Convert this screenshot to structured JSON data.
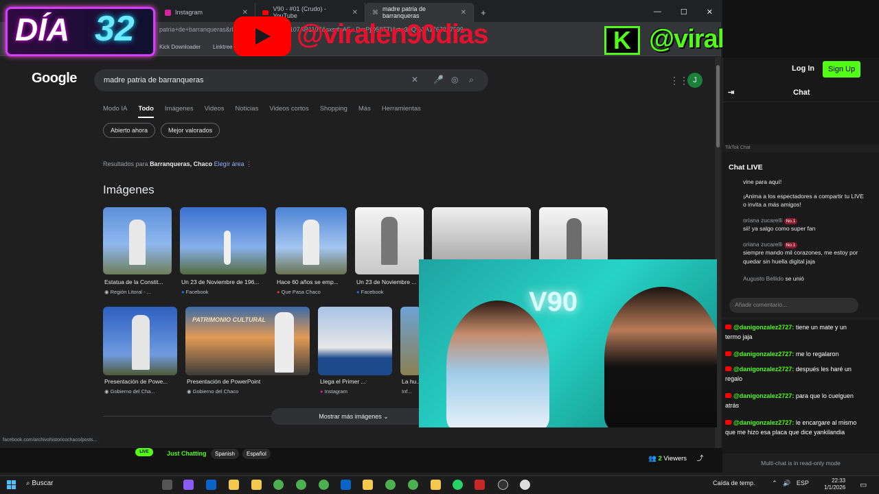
{
  "browser": {
    "tabs": [
      {
        "label": "Instagram",
        "icon": "instagram-icon"
      },
      {
        "label": "V90 - #01 (Crudo) - YouTube",
        "icon": "youtube-icon"
      },
      {
        "label": "madre patria de barranqueras",
        "icon": "google-icon"
      }
    ],
    "address": "patria+de+barranqueras&rlz=1C1CHBF_esAR1107AR1107&sxsrf=AE...DmPjQ58TTI&rtw39Q%3A1767317599",
    "bookmarks": [
      "Kick Downloader",
      "Linktree"
    ]
  },
  "google": {
    "logo": "Google",
    "query": "madre patria de barranqueras",
    "avatar_letter": "J",
    "tabs": [
      "Modo IA",
      "Todo",
      "Imágenes",
      "Videos",
      "Noticias",
      "Videos cortos",
      "Shopping",
      "Más",
      "Herramientas"
    ],
    "chips": [
      "Abierto ahora",
      "Mejor valorados"
    ],
    "location_prefix": "Resultados para",
    "location_place": "Barranqueras, Chaco",
    "location_link": "Elegír área",
    "images_title": "Imágenes",
    "row1": [
      {
        "caption": "Estatua de la Constit...",
        "source": "Región Litoral - ..."
      },
      {
        "caption": "Un 23 de Noviembre de 196...",
        "source": "Facebook"
      },
      {
        "caption": "Hace 60 años se emp...",
        "source": "Que Pasa Chaco"
      },
      {
        "caption": "Un 23 de Noviembre ...",
        "source": "Facebook"
      }
    ],
    "row2": [
      {
        "caption": "Presentación de Powe...",
        "source": "Gobierno del Cha..."
      },
      {
        "caption": "Presentación de PowerPoint",
        "source": "Gobierno del Chaco",
        "overlay": "PATRIMONIO CULTURAL"
      },
      {
        "caption": "Llega el Primer ...",
        "source": "Instagram"
      },
      {
        "caption": "La hu...",
        "source": "Inf..."
      }
    ],
    "more_images": "Mostrar más imágenes",
    "status_url": "facebook.com/archivohistoricochaco/posts..."
  },
  "overlay": {
    "day_word": "DÍA",
    "day_number": "32",
    "yt_handle": "@viralen90dias",
    "kick_letter": "K",
    "kick_handle": "@viralen90dias",
    "cam_sign": "V90"
  },
  "kick": {
    "login": "Log In",
    "signup": "Sign Up",
    "chat_title": "Chat",
    "live_badge": "LIVE",
    "category": "Just Chatting",
    "tags": [
      "Spanish",
      "Español"
    ],
    "viewers_count": "2",
    "viewers_label": "Viewers",
    "read_only": "Multi-chat is in read-only mode",
    "messages": [
      {
        "user": "@danigonzalez2727:",
        "text": "tiene un mate y un termo jaja"
      },
      {
        "user": "@danigonzalez2727:",
        "text": "me lo regalaron"
      },
      {
        "user": "@danigonzalez2727:",
        "text": "después les haré un regalo"
      },
      {
        "user": "@danigonzalez2727:",
        "text": "para que lo cuelguen atrás"
      },
      {
        "user": "@danigonzalez2727:",
        "text": "le encargare al mismo que me hizo esa placa que dice yankilandia"
      }
    ]
  },
  "tiktok": {
    "label": "TikTok Chat",
    "title": "Chat LIVE",
    "items": [
      {
        "name": "",
        "badge": "",
        "text": "vine para aquí!"
      },
      {
        "name": "",
        "badge": "",
        "text": "¡Anima a los espectadores a compartir tu LIVE o invita a más amigos!"
      },
      {
        "name": "oriana zucarelli",
        "badge": "No.1",
        "text": "sii! ya salgo como super fan"
      },
      {
        "name": "oriana zucarelli",
        "badge": "No.1",
        "text": "siempre mando mil corazones, me estoy por quedar sin huella digital jaja"
      },
      {
        "name": "Augusto Bellido",
        "badge": "",
        "text": "se unió"
      }
    ],
    "input_placeholder": "Añadir comentario..."
  },
  "taskbar": {
    "search": "Buscar",
    "weather": "Caída de temp.",
    "lang": "ESP",
    "time": "22:33",
    "date": "1/1/2026"
  }
}
